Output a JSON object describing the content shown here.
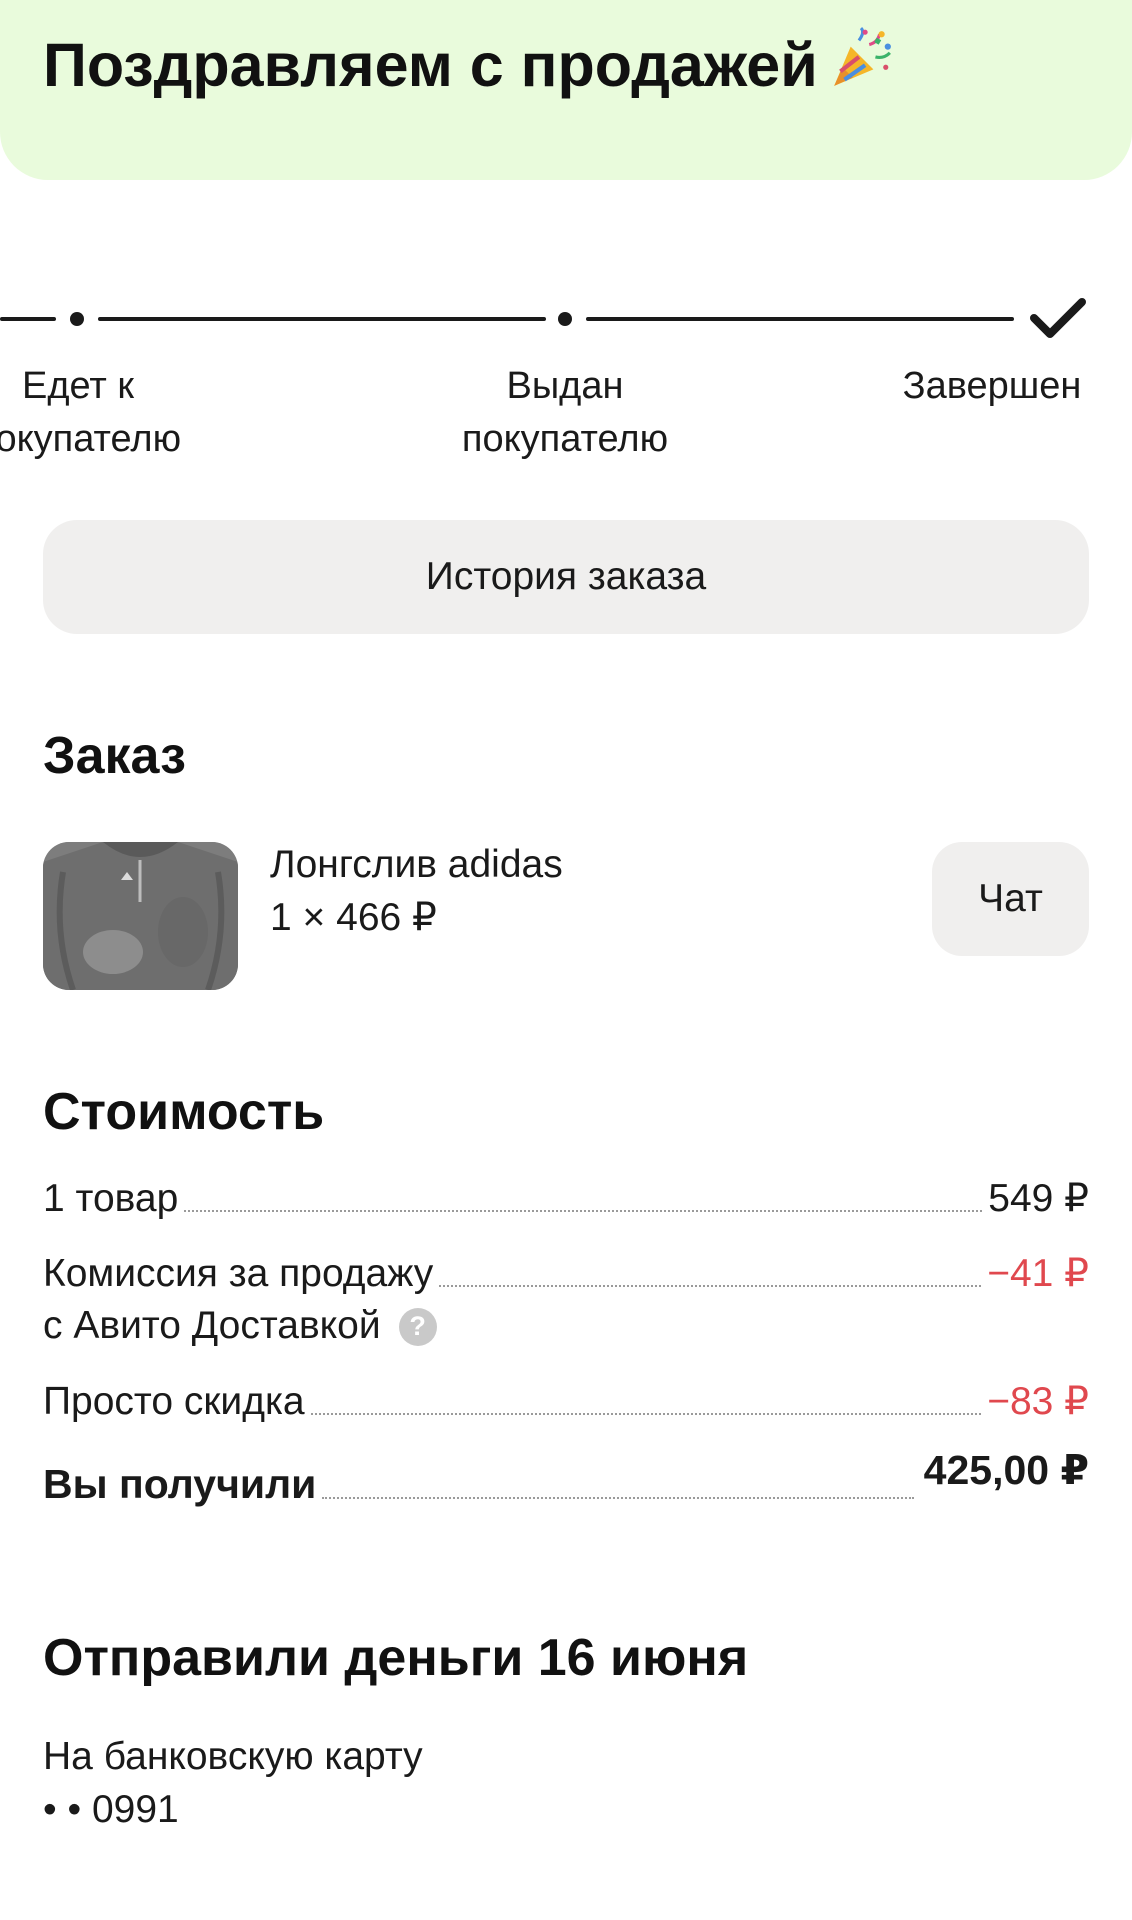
{
  "banner": {
    "title": "Поздравляем с продажей"
  },
  "progress": {
    "steps": [
      {
        "line1": "Едет к",
        "line2": "покупателю"
      },
      {
        "line1": "Выдан",
        "line2": "покупателю"
      },
      {
        "line1": "Завершен",
        "line2": ""
      }
    ]
  },
  "history_button": {
    "label": "История заказа"
  },
  "order": {
    "title": "Заказ",
    "item_name": "Лонгслив adidas",
    "item_qty": "1 × 466 ₽",
    "chat_label": "Чат"
  },
  "cost": {
    "title": "Стоимость",
    "rows": [
      {
        "label": "1 товар",
        "value": "549 ₽"
      },
      {
        "label": "Комиссия за продажу",
        "label2": "с Авито Доставкой",
        "value": "−41 ₽"
      },
      {
        "label": "Просто скидка",
        "value": "−83 ₽"
      },
      {
        "label": "Вы получили",
        "value": "425,00 ₽"
      }
    ]
  },
  "payout": {
    "title": "Отправили деньги 16 июня",
    "method": "На банковскую карту",
    "card": "• • 0991"
  },
  "colors": {
    "banner_bg": "#e9fbdc",
    "negative": "#e0484e",
    "button_bg": "#f0efee"
  }
}
